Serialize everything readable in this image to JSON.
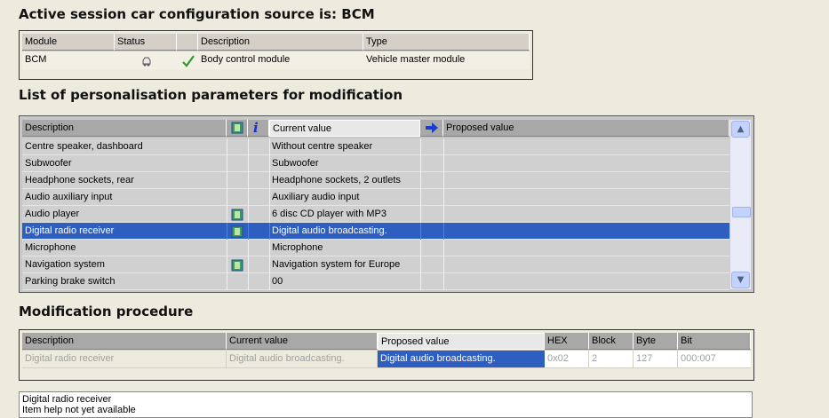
{
  "session_title": "Active session car configuration source is: BCM",
  "module_table": {
    "headers": [
      "Module",
      "Status",
      "",
      "Description",
      "Type"
    ],
    "row": {
      "module": "BCM",
      "status_icon": "car-status-icon",
      "check_icon": "green-check-icon",
      "description": "Body control module",
      "type": "Vehicle master module"
    }
  },
  "params_title": "List of personalisation parameters for modification",
  "params_table": {
    "headers": {
      "description": "Description",
      "icon1": "module-icon",
      "icon2": "info-icon",
      "current": "Current value",
      "arrow": "arrow-right-icon",
      "proposed": "Proposed value"
    },
    "rows": [
      {
        "description": "Centre speaker, dashboard",
        "has_icon": false,
        "current": "Without centre speaker",
        "proposed": ""
      },
      {
        "description": "Subwoofer",
        "has_icon": false,
        "current": "Subwoofer",
        "proposed": ""
      },
      {
        "description": "Headphone sockets, rear",
        "has_icon": false,
        "current": "Headphone sockets, 2 outlets",
        "proposed": ""
      },
      {
        "description": "Audio auxiliary input",
        "has_icon": false,
        "current": "Auxiliary audio input",
        "proposed": ""
      },
      {
        "description": "Audio player",
        "has_icon": true,
        "current": "6 disc CD player with MP3",
        "proposed": ""
      },
      {
        "description": "Digital radio receiver",
        "has_icon": true,
        "current": "Digital audio broadcasting.",
        "proposed": "",
        "selected": true
      },
      {
        "description": "Microphone",
        "has_icon": false,
        "current": "Microphone",
        "proposed": ""
      },
      {
        "description": "Navigation system",
        "has_icon": true,
        "current": "Navigation system for Europe",
        "proposed": ""
      },
      {
        "description": "Parking brake switch",
        "has_icon": false,
        "current": "00",
        "proposed": ""
      }
    ]
  },
  "procedure_title": "Modification procedure",
  "procedure_table": {
    "headers": [
      "Description",
      "Current value",
      "Proposed value",
      "HEX",
      "Block",
      "Byte",
      "Bit"
    ],
    "row": {
      "description": "Digital radio receiver",
      "current": "Digital audio broadcasting.",
      "proposed": "Digital audio broadcasting.",
      "hex": "0x02",
      "block": "2",
      "byte": "127",
      "bit": "000:007"
    }
  },
  "help": {
    "line1": "Digital radio receiver",
    "line2": "Item help not yet available"
  },
  "colors": {
    "selection": "#2e5ec0",
    "background": "#ecebdd",
    "header": "#d4d0c8"
  }
}
